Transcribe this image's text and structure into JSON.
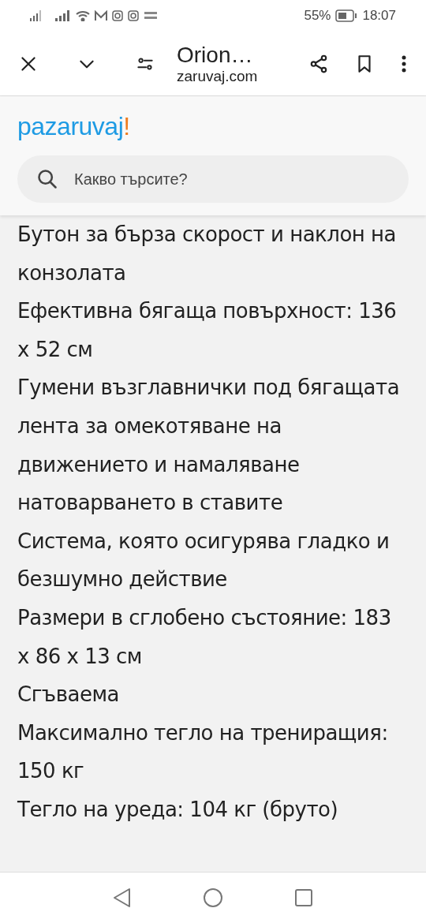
{
  "status_bar": {
    "battery": "55%",
    "time": "18:07"
  },
  "toolbar": {
    "title": "Orion…",
    "url": "zaruvaj.com"
  },
  "header": {
    "logo": "pazaruvaj",
    "logo_mark": "!",
    "search": {
      "placeholder": "Какво търсите?"
    }
  },
  "features": [
    {
      "text": "Бутон за бърза скорост и наклон на конзолата"
    },
    {
      "text": "Ефективна бягаща повърхност: 136 x 52 см"
    },
    {
      "text": "Гумени възглавнички под бягащата лента за омекотяване на движението и намаляване натоварването в ставите"
    },
    {
      "text": "Система, която осигурява гладко и безшумно действие"
    },
    {
      "text": "Размери в сглобено състояние: 183 x 86 x 13 см"
    },
    {
      "text": "Сгъваема"
    },
    {
      "text": "Максимално тегло на трениращия: 150 кг"
    },
    {
      "text": "Тегло на уреда: 104 кг (бруто)"
    }
  ]
}
